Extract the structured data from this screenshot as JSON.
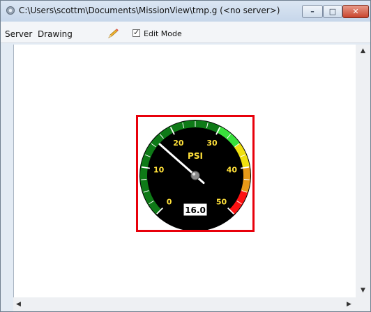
{
  "window": {
    "title": "C:\\Users\\scottm\\Documents\\MissionView\\tmp.g (<no server>)",
    "app_icon": "gear-icon",
    "controls": {
      "minimize": "minimize-icon",
      "maximize": "maximize-icon",
      "close": "close-icon"
    }
  },
  "menu": {
    "items": [
      "Server",
      "Drawing"
    ],
    "pencil_icon": "pencil-icon",
    "edit_mode": {
      "label": "Edit Mode",
      "checked": true
    }
  },
  "gauge": {
    "unit": "PSI",
    "tick_labels": [
      "0",
      "10",
      "20",
      "30",
      "40",
      "50"
    ],
    "min": 0,
    "max": 50,
    "value": 16.0,
    "display": "16.0",
    "zones": [
      {
        "from": 0,
        "to": 30,
        "color": "#0e7a17"
      },
      {
        "from": 30,
        "to": 35,
        "color": "#39e03c"
      },
      {
        "from": 35,
        "to": 40,
        "color": "#f0e010"
      },
      {
        "from": 40,
        "to": 45,
        "color": "#e89a18"
      },
      {
        "from": 45,
        "to": 50,
        "color": "#ff1212"
      }
    ],
    "label_color": "#ffe03a"
  },
  "colors": {
    "selection_border": "#e8000b",
    "canvas": "#ffffff"
  }
}
